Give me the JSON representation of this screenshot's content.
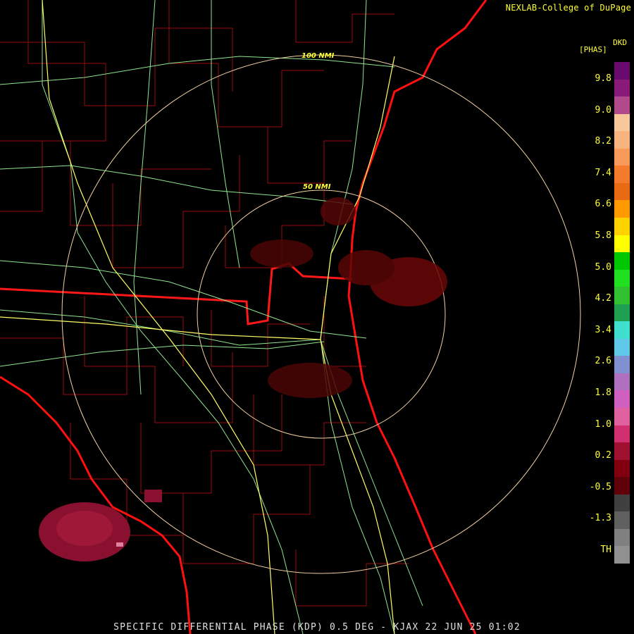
{
  "credit": "NEXLAB-College of DuPage",
  "footer": "SPECIFIC DIFFERENTIAL PHASE (KDP) 0.5 DEG - KJAX 22 JUN 25 01:02",
  "legend": {
    "product": "DKD",
    "unit": "[PHAS]",
    "labels": [
      "9.8",
      "9.0",
      "8.2",
      "7.4",
      "6.6",
      "5.8",
      "5.0",
      "4.2",
      "3.4",
      "2.6",
      "1.8",
      "1.0",
      "0.2",
      "-0.5",
      "-1.3",
      "TH"
    ],
    "colors": [
      "#6a0a6e",
      "#8a1a7a",
      "#b04a8a",
      "#f8c89a",
      "#f8b480",
      "#f89a5a",
      "#f47a2c",
      "#e86a12",
      "#ff9a00",
      "#ffd200",
      "#ffff00",
      "#00c800",
      "#20e020",
      "#30c030",
      "#1fa050",
      "#40e0d0",
      "#60c8e8",
      "#8090d0",
      "#b070c0",
      "#d060c0",
      "#e060a0",
      "#d03070",
      "#a01030",
      "#800010",
      "#600008",
      "#404040",
      "#606060",
      "#808080",
      "#909090"
    ]
  },
  "range_rings": [
    "100 NMI",
    "50 NMI"
  ],
  "colors": {
    "background": "#000000",
    "counties": "#a01010",
    "coast": "#ff1010",
    "roads": "#88ee88",
    "rings": "#f0d0a0",
    "text": "#ffff33"
  }
}
